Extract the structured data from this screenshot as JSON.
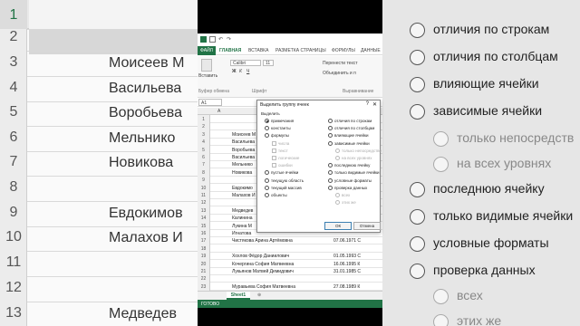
{
  "left_bg": {
    "rows": [
      "1",
      "2",
      "3",
      "4",
      "5",
      "6",
      "7",
      "8",
      "9",
      "10",
      "11",
      "12",
      "13"
    ],
    "names": [
      "Моисеев М",
      "Васильева",
      "Воробьева",
      "Мельнико",
      "Новикова",
      "Евдокимов",
      "Малахов И",
      "Медведев"
    ]
  },
  "right_bg": {
    "options": [
      "отличия по строкам",
      "отличия по столбцам",
      "влияющие ячейки",
      "зависимые ячейки",
      "только непосредств",
      "на всех уровнях",
      "последнюю ячейку",
      "только видимые ячейки",
      "условные форматы",
      "проверка данных",
      "всех",
      "этих же"
    ]
  },
  "excel": {
    "tabs": [
      "ФАЙЛ",
      "ГЛАВНАЯ",
      "ВСТАВКА",
      "РАЗМЕТКА СТРАНИЦЫ",
      "ФОРМУЛЫ",
      "ДАННЫЕ"
    ],
    "paste_label": "Вставить",
    "font_name": "Calibri",
    "font_size": "11",
    "wrap_text": "Перенести текст",
    "merge": "Объединить и п",
    "clipboard_group": "Буфер обмена",
    "font_group": "Шрифт",
    "align_group": "Выравнивание",
    "name_box": "A1",
    "col_a": "A",
    "rows": [
      {
        "n": "1",
        "v": "",
        "d": ""
      },
      {
        "n": "2",
        "v": "",
        "d": ""
      },
      {
        "n": "3",
        "v": "Моисеев М",
        "d": ""
      },
      {
        "n": "4",
        "v": "Васильева",
        "d": ""
      },
      {
        "n": "5",
        "v": "Воробьева",
        "d": ""
      },
      {
        "n": "6",
        "v": "Васильева",
        "d": ""
      },
      {
        "n": "7",
        "v": "Мельнико",
        "d": ""
      },
      {
        "n": "8",
        "v": "Новикова",
        "d": ""
      },
      {
        "n": "9",
        "v": "",
        "d": ""
      },
      {
        "n": "10",
        "v": "Евдокимо",
        "d": ""
      },
      {
        "n": "11",
        "v": "Малахов И",
        "d": ""
      },
      {
        "n": "12",
        "v": "",
        "d": ""
      },
      {
        "n": "13",
        "v": "Медведев",
        "d": ""
      },
      {
        "n": "14",
        "v": "Калинина",
        "d": ""
      },
      {
        "n": "15",
        "v": "Лукина М",
        "d": ""
      },
      {
        "n": "16",
        "v": "Игнатова",
        "d": ""
      },
      {
        "n": "17",
        "v": "Чистякова Арина Артёмовна",
        "d": "07.06.1971 С"
      },
      {
        "n": "18",
        "v": "",
        "d": ""
      },
      {
        "n": "19",
        "v": "Хохлов Фёдор Даниилович",
        "d": "01.05.1993 С"
      },
      {
        "n": "20",
        "v": "Кочергина София Матвеевна",
        "d": "16.06.1995 К"
      },
      {
        "n": "21",
        "v": "Лукьянов Матвей Демидович",
        "d": "31.01.1985 С"
      },
      {
        "n": "22",
        "v": "",
        "d": ""
      },
      {
        "n": "23",
        "v": "Муравьева София Матвеевна",
        "d": "27.08.1989 К"
      }
    ],
    "sheet_tab": "Sheet1",
    "status": "ГОТОВО"
  },
  "dialog": {
    "title": "Выделить группу ячеек",
    "help": "?",
    "close": "✕",
    "group_label": "Выделить",
    "left_options": [
      {
        "label": "примечания",
        "checked": true,
        "disabled": false,
        "indent": false
      },
      {
        "label": "константы",
        "checked": false,
        "disabled": false,
        "indent": false
      },
      {
        "label": "формулы",
        "checked": false,
        "disabled": false,
        "indent": false
      },
      {
        "label": "числа",
        "checked": false,
        "disabled": true,
        "indent": true
      },
      {
        "label": "текст",
        "checked": false,
        "disabled": true,
        "indent": true
      },
      {
        "label": "логические",
        "checked": false,
        "disabled": true,
        "indent": true
      },
      {
        "label": "ошибки",
        "checked": false,
        "disabled": true,
        "indent": true
      },
      {
        "label": "пустые ячейки",
        "checked": false,
        "disabled": false,
        "indent": false
      },
      {
        "label": "текущую область",
        "checked": false,
        "disabled": false,
        "indent": false
      },
      {
        "label": "текущий массив",
        "checked": false,
        "disabled": false,
        "indent": false
      },
      {
        "label": "объекты",
        "checked": false,
        "disabled": false,
        "indent": false
      }
    ],
    "right_options": [
      {
        "label": "отличия по строкам",
        "disabled": false,
        "indent": false
      },
      {
        "label": "отличия по столбцам",
        "disabled": false,
        "indent": false
      },
      {
        "label": "влияющие ячейки",
        "disabled": false,
        "indent": false
      },
      {
        "label": "зависимые ячейки",
        "disabled": false,
        "indent": false
      },
      {
        "label": "только непосредстве",
        "disabled": true,
        "indent": true
      },
      {
        "label": "на всех уровнях",
        "disabled": true,
        "indent": true
      },
      {
        "label": "последнюю ячейку",
        "disabled": false,
        "indent": false
      },
      {
        "label": "только видимые ячейки",
        "disabled": false,
        "indent": false
      },
      {
        "label": "условные форматы",
        "disabled": false,
        "indent": false
      },
      {
        "label": "проверка данных",
        "disabled": false,
        "indent": false
      },
      {
        "label": "всех",
        "disabled": true,
        "indent": true
      },
      {
        "label": "этих же",
        "disabled": true,
        "indent": true
      }
    ],
    "ok": "ОК",
    "cancel": "Отмена"
  }
}
